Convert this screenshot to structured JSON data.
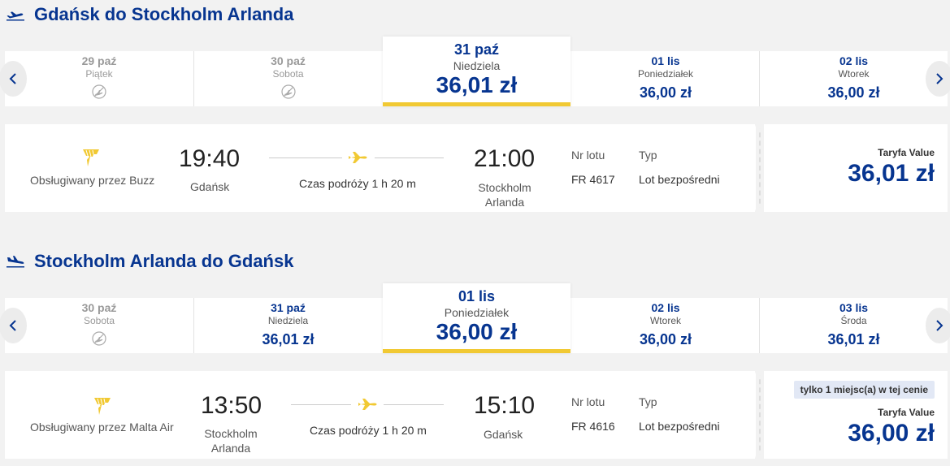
{
  "outbound": {
    "title": "Gdańsk do Stockholm Arlanda",
    "days": [
      {
        "date": "29 paź",
        "day": "Piątek",
        "available": false,
        "price": ""
      },
      {
        "date": "30 paź",
        "day": "Sobota",
        "available": false,
        "price": ""
      },
      {
        "date": "31 paź",
        "day": "Niedziela",
        "available": true,
        "price": "36,01 zł",
        "selected": true
      },
      {
        "date": "01 lis",
        "day": "Poniedziałek",
        "available": true,
        "price": "36,00 zł"
      },
      {
        "date": "02 lis",
        "day": "Wtorek",
        "available": true,
        "price": "36,00 zł"
      }
    ],
    "flight": {
      "operator": "Obsługiwany przez Buzz",
      "dep_time": "19:40",
      "dep_city": "Gdańsk",
      "duration": "Czas podróży 1 h 20 m",
      "arr_time": "21:00",
      "arr_city_1": "Stockholm",
      "arr_city_2": "Arlanda",
      "flight_no_label": "Nr lotu",
      "flight_no": "FR 4617",
      "type_label": "Typ",
      "type": "Lot bezpośredni",
      "fare_label": "Taryfa Value",
      "price": "36,01 zł"
    }
  },
  "inbound": {
    "title": "Stockholm Arlanda do Gdańsk",
    "days": [
      {
        "date": "30 paź",
        "day": "Sobota",
        "available": false,
        "price": ""
      },
      {
        "date": "31 paź",
        "day": "Niedziela",
        "available": true,
        "price": "36,01 zł"
      },
      {
        "date": "01 lis",
        "day": "Poniedziałek",
        "available": true,
        "price": "36,00 zł",
        "selected": true
      },
      {
        "date": "02 lis",
        "day": "Wtorek",
        "available": true,
        "price": "36,00 zł"
      },
      {
        "date": "03 lis",
        "day": "Środa",
        "available": true,
        "price": "36,01 zł"
      }
    ],
    "flight": {
      "operator": "Obsługiwany przez Malta Air",
      "dep_time": "13:50",
      "dep_city_1": "Stockholm",
      "dep_city_2": "Arlanda",
      "duration": "Czas podróży 1 h 20 m",
      "arr_time": "15:10",
      "arr_city": "Gdańsk",
      "flight_no_label": "Nr lotu",
      "flight_no": "FR 4616",
      "type_label": "Typ",
      "type": "Lot bezpośredni",
      "badge": "tylko 1 miejsc(a) w tej cenie",
      "fare_label": "Taryfa Value",
      "price": "36,00 zł"
    }
  },
  "icons": {
    "takeoff": "takeoff-icon",
    "landing": "landing-icon",
    "prev": "chevron-left-icon",
    "next": "chevron-right-icon",
    "no_flight": "no-flight-icon",
    "airline_logo": "harp-logo-icon"
  },
  "colors": {
    "brand_blue": "#073590",
    "accent_yellow": "#f1c933"
  }
}
